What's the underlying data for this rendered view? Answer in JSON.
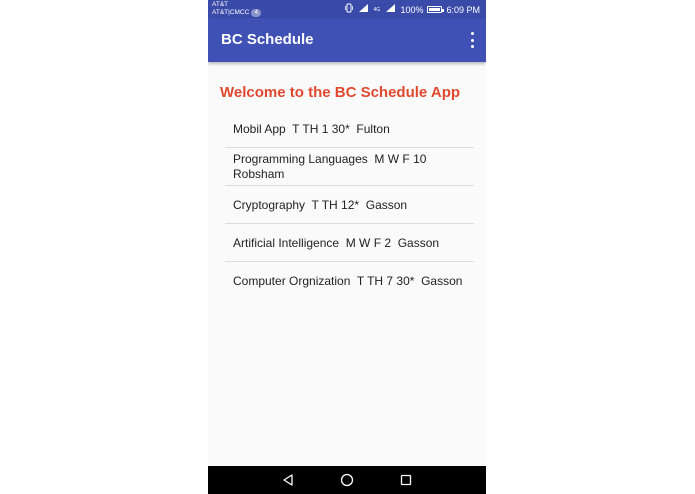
{
  "status_bar": {
    "carrier_line1": "AT&T",
    "carrier_line2": "AT&T|CMCC",
    "notification_count": "4",
    "battery_percent": "100%",
    "time": "6:09 PM",
    "net_label": "4G"
  },
  "app_bar": {
    "title": "BC Schedule"
  },
  "main": {
    "welcome": "Welcome to the BC Schedule App",
    "courses": [
      "Mobil App  T TH 1 30*  Fulton",
      "Programming Languages  M W F 10  Robsham",
      "Cryptography  T TH 12*  Gasson",
      "Artificial Intelligence  M W F 2  Gasson",
      "Computer Orgnization  T TH 7 30*  Gasson"
    ]
  },
  "colors": {
    "app_bar": "#3f51b5",
    "status_bar": "#3a4aa8",
    "welcome_text": "#e0492f",
    "background": "#fafafa"
  },
  "icons": {
    "overflow": "more-vert-icon",
    "nav_back": "back-triangle-icon",
    "nav_home": "home-circle-icon",
    "nav_recent": "recents-square-icon"
  }
}
